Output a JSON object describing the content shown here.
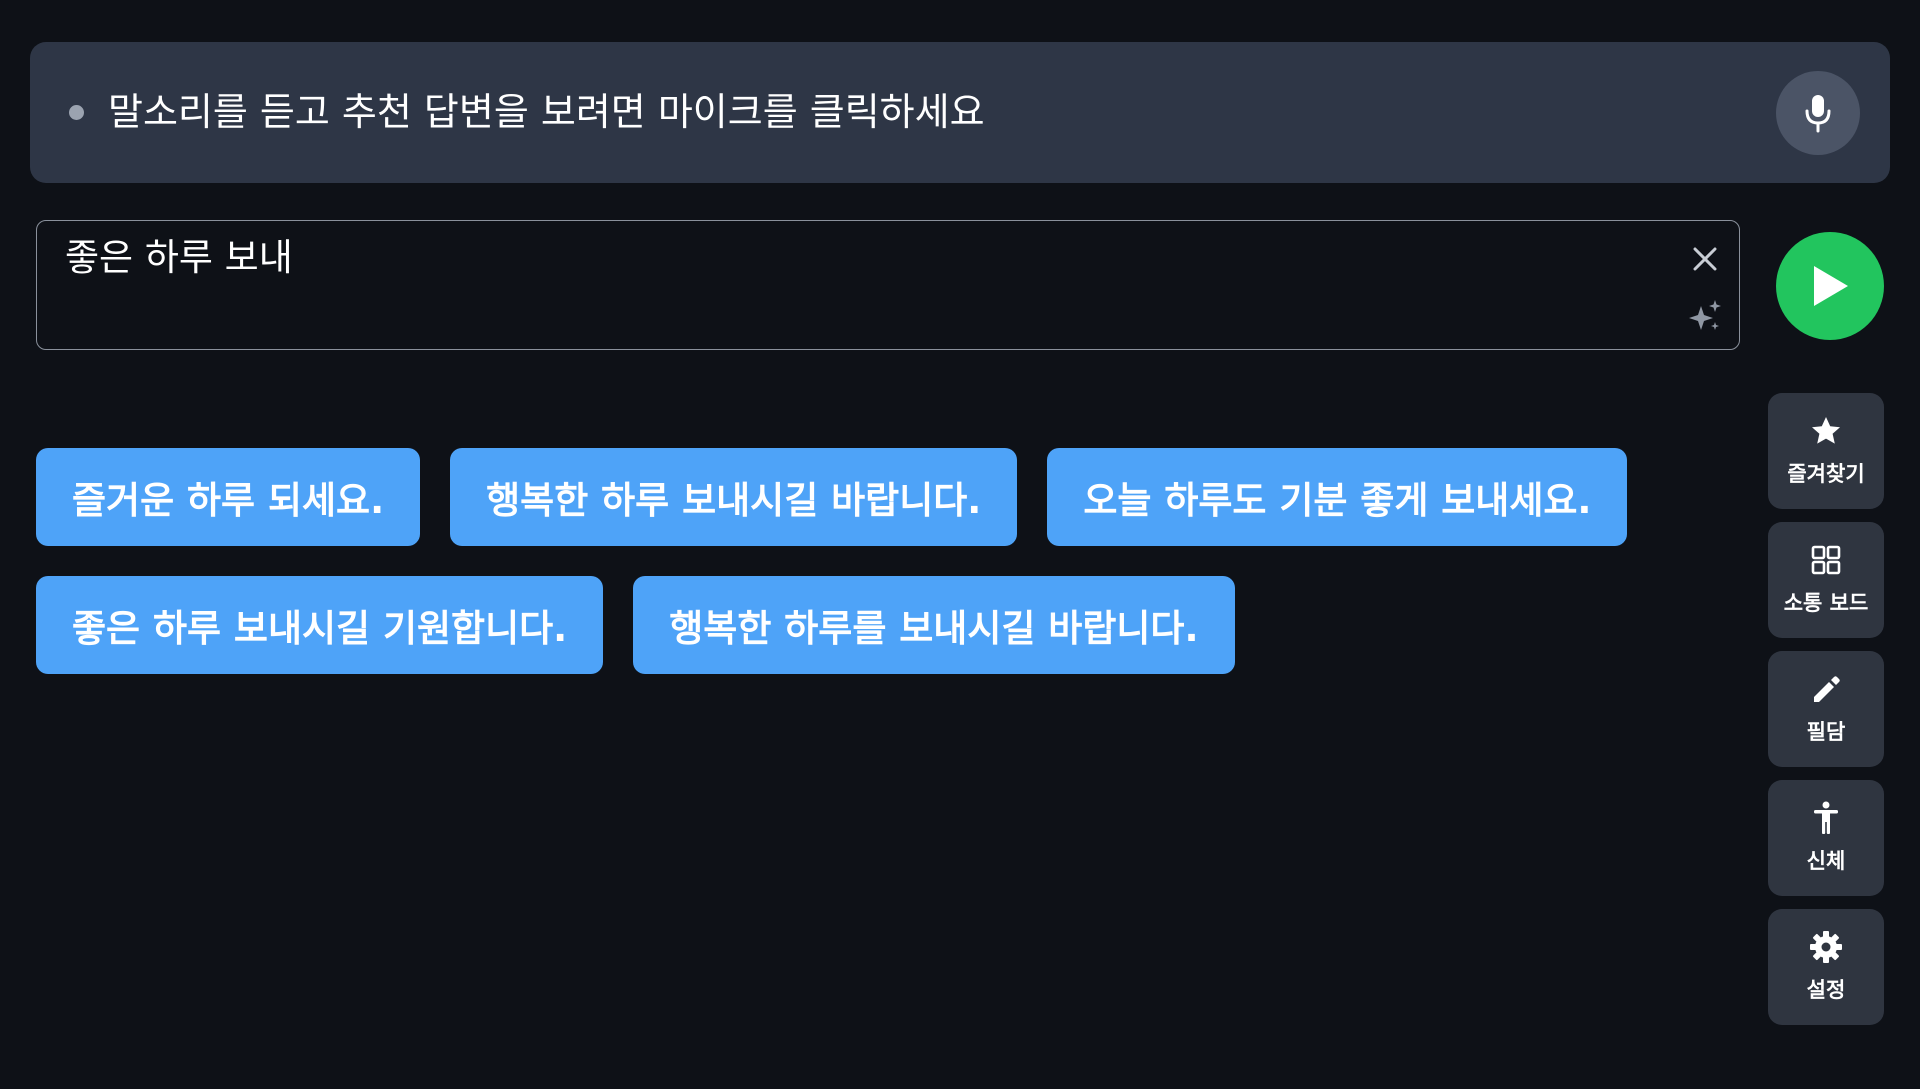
{
  "listening": {
    "status_text": "말소리를 듣고 추천 답변을 보려면 마이크를 클릭하세요",
    "mic_icon": "microphone-icon"
  },
  "input": {
    "value": "좋은 하루 보내",
    "clear_icon": "close-icon",
    "ai_icon": "sparkle-icon"
  },
  "speak_button": {
    "icon": "play-icon",
    "color": "#22c55e"
  },
  "suggestions": {
    "row1": [
      "즐거운 하루 되세요.",
      "행복한 하루 보내시길 바랍니다.",
      "오늘 하루도 기분 좋게 보내세요."
    ],
    "row2": [
      "좋은 하루 보내시길 기원합니다.",
      "행복한 하루를 보내시길 바랍니다."
    ],
    "color": "#4ea3f8"
  },
  "side_menu": [
    {
      "label": "즐겨찾기",
      "icon": "star-icon"
    },
    {
      "label": "소통 보드",
      "icon": "grid-icon"
    },
    {
      "label": "필담",
      "icon": "pencil-icon"
    },
    {
      "label": "신체",
      "icon": "body-icon"
    },
    {
      "label": "설정",
      "icon": "gear-icon"
    }
  ]
}
